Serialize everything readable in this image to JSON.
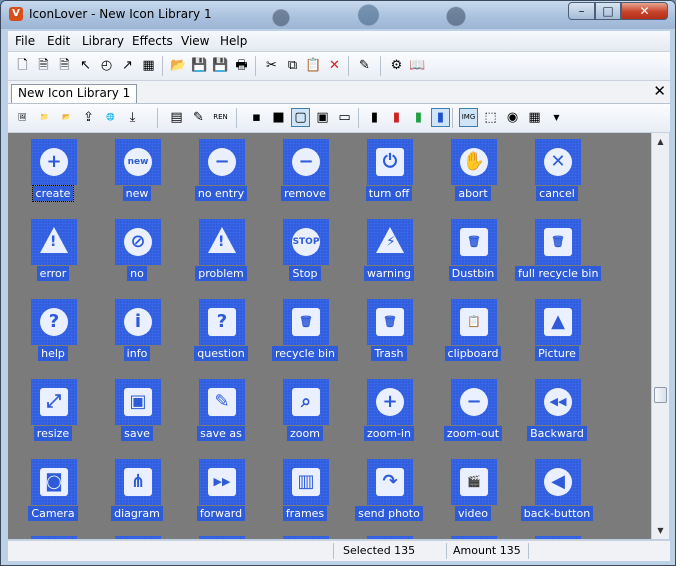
{
  "window": {
    "title": "IconLover - New Icon Library 1",
    "min": "–",
    "max": "□",
    "close": "✕"
  },
  "menu": [
    "File",
    "Edit",
    "Library",
    "Effects",
    "View",
    "Help"
  ],
  "toolbar1": [
    {
      "name": "new-file-icon",
      "glyph": "🗋"
    },
    {
      "name": "new-icon-icon",
      "glyph": "🗎"
    },
    {
      "name": "new-document-icon",
      "glyph": "🗎"
    },
    {
      "name": "new-cursor-icon",
      "glyph": "↖"
    },
    {
      "name": "new-animated-icon",
      "glyph": "◴"
    },
    {
      "name": "new-animated-cursor-icon",
      "glyph": "↗"
    },
    {
      "name": "new-library-icon",
      "glyph": "▦"
    },
    {
      "name": "open-folder-icon",
      "glyph": "📂"
    },
    {
      "name": "save-icon",
      "glyph": "💾"
    },
    {
      "name": "save-all-icon",
      "glyph": "💾"
    },
    {
      "name": "print-icon",
      "glyph": "🖶"
    },
    {
      "name": "cut-icon",
      "glyph": "✂"
    },
    {
      "name": "copy-icon",
      "glyph": "⧉"
    },
    {
      "name": "paste-icon",
      "glyph": "📋"
    },
    {
      "name": "delete-icon",
      "glyph": "✕"
    },
    {
      "name": "properties-icon",
      "glyph": "✎"
    },
    {
      "name": "tools-icon",
      "glyph": "⚙"
    },
    {
      "name": "help-book-icon",
      "glyph": "📖"
    }
  ],
  "tab": {
    "label": "New Icon Library 1",
    "close": "✕"
  },
  "toolbar2": [
    {
      "name": "add-image-icon",
      "glyph": "🖼"
    },
    {
      "name": "add-folder-icon",
      "glyph": "📁"
    },
    {
      "name": "open-icon",
      "glyph": "📂"
    },
    {
      "name": "export-icon",
      "glyph": "⇪"
    },
    {
      "name": "web-icon",
      "glyph": "🌐"
    },
    {
      "name": "download-icon",
      "glyph": "⤓"
    },
    {
      "name": "layers-icon",
      "glyph": "▤"
    },
    {
      "name": "edit-pen-icon",
      "glyph": "✎"
    },
    {
      "name": "rename-icon",
      "glyph": "REN"
    },
    {
      "name": "view-tiny-icon",
      "glyph": "▪"
    },
    {
      "name": "view-small-icon",
      "glyph": "■"
    },
    {
      "name": "view-large-icon",
      "glyph": "▢"
    },
    {
      "name": "view-details-icon",
      "glyph": "▣"
    },
    {
      "name": "view-list-icon",
      "glyph": "▭"
    },
    {
      "name": "mono-color-icon",
      "glyph": "▮"
    },
    {
      "name": "color-16-icon",
      "glyph": "▮"
    },
    {
      "name": "color-256-icon",
      "glyph": "▮"
    },
    {
      "name": "color-true-icon",
      "glyph": "▮"
    },
    {
      "name": "img-format-icon",
      "glyph": "IMG"
    },
    {
      "name": "resize-tool-icon",
      "glyph": "⬚"
    },
    {
      "name": "preview-icon",
      "glyph": "◉"
    },
    {
      "name": "effects-icon",
      "glyph": "▦"
    },
    {
      "name": "dropdown-arrow-icon",
      "glyph": "▼"
    }
  ],
  "icons": [
    {
      "label": "create",
      "glyph": "+",
      "shape": "circle"
    },
    {
      "label": "new",
      "glyph": "new",
      "shape": "circle"
    },
    {
      "label": "no entry",
      "glyph": "−",
      "shape": "circle"
    },
    {
      "label": "remove",
      "glyph": "−",
      "shape": "circle"
    },
    {
      "label": "turn off",
      "glyph": "⏻",
      "shape": "square"
    },
    {
      "label": "abort",
      "glyph": "✋",
      "shape": "circle"
    },
    {
      "label": "cancel",
      "glyph": "✕",
      "shape": "circle"
    },
    {
      "label": "error",
      "glyph": "!",
      "shape": "triangle"
    },
    {
      "label": "no",
      "glyph": "⊘",
      "shape": "circle"
    },
    {
      "label": "problem",
      "glyph": "!",
      "shape": "triangle"
    },
    {
      "label": "Stop",
      "glyph": "STOP",
      "shape": "circle"
    },
    {
      "label": "warning",
      "glyph": "⚡",
      "shape": "triangle"
    },
    {
      "label": "Dustbin",
      "glyph": "🗑",
      "shape": "square"
    },
    {
      "label": "full recycle bin",
      "glyph": "🗑",
      "shape": "square"
    },
    {
      "label": "help",
      "glyph": "?",
      "shape": "circle"
    },
    {
      "label": "info",
      "glyph": "i",
      "shape": "circle"
    },
    {
      "label": "question",
      "glyph": "?",
      "shape": "square"
    },
    {
      "label": "recycle bin",
      "glyph": "🗑",
      "shape": "square"
    },
    {
      "label": "Trash",
      "glyph": "🗑",
      "shape": "square"
    },
    {
      "label": "clipboard",
      "glyph": "📋",
      "shape": "square"
    },
    {
      "label": "Picture",
      "glyph": "▲",
      "shape": "square"
    },
    {
      "label": "resize",
      "glyph": "⤢",
      "shape": "square"
    },
    {
      "label": "save",
      "glyph": "▣",
      "shape": "square"
    },
    {
      "label": "save as",
      "glyph": "✎",
      "shape": "square"
    },
    {
      "label": "zoom",
      "glyph": "⌕",
      "shape": "square"
    },
    {
      "label": "zoom-in",
      "glyph": "+",
      "shape": "circle"
    },
    {
      "label": "zoom-out",
      "glyph": "−",
      "shape": "circle"
    },
    {
      "label": "Backward",
      "glyph": "◀◀",
      "shape": "circle"
    },
    {
      "label": "Camera",
      "glyph": "◙",
      "shape": "square"
    },
    {
      "label": "diagram",
      "glyph": "⋔",
      "shape": "square"
    },
    {
      "label": "forward",
      "glyph": "▶▶",
      "shape": "square"
    },
    {
      "label": "frames",
      "glyph": "▥",
      "shape": "square"
    },
    {
      "label": "send photo",
      "glyph": "↷",
      "shape": "square"
    },
    {
      "label": "video",
      "glyph": "🎬",
      "shape": "square"
    },
    {
      "label": "back-button",
      "glyph": "◀",
      "shape": "circle"
    }
  ],
  "selected_icon": "create",
  "status": {
    "selected": "Selected 135",
    "amount": "Amount 135"
  },
  "colors": {
    "tile": "#2e5bd8",
    "grid_bg": "#7b7b7b"
  }
}
